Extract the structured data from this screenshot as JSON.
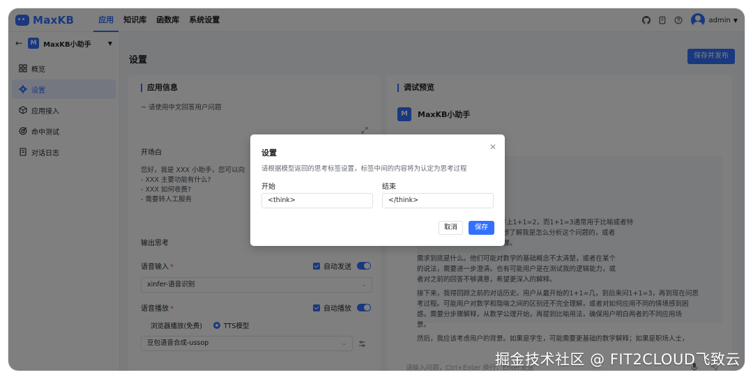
{
  "brand": {
    "name": "MaxKB",
    "color": "#3370ff"
  },
  "nav": {
    "items": [
      "应用",
      "知识库",
      "函数库",
      "系统设置"
    ],
    "active_index": 0
  },
  "topbar": {
    "user": "admin",
    "icons": [
      "github-icon",
      "book-icon",
      "help-icon"
    ]
  },
  "sidebar": {
    "app_badge": "M",
    "app_name": "MaxKB小助手",
    "items": [
      {
        "label": "概览",
        "icon": "grid-icon"
      },
      {
        "label": "设置",
        "icon": "gear-icon"
      },
      {
        "label": "应用接入",
        "icon": "cube-icon"
      },
      {
        "label": "命中测试",
        "icon": "target-icon"
      },
      {
        "label": "对话日志",
        "icon": "document-icon"
      }
    ],
    "active_index": 1
  },
  "main": {
    "title": "设置",
    "publish_label": "保存并发布"
  },
  "left_panel": {
    "title": "应用信息",
    "prompt_line": "~ 请使用中文回答用户问题",
    "opening_label": "开场白",
    "opening_lines": [
      "您好，我是 XXX 小助手，您可以向",
      "- XXX 主要功能有什么?",
      "- XXX 如何收费?",
      "- 需要转人工服务"
    ],
    "output_think_label": "输出思考",
    "voice_input": {
      "label": "语音输入",
      "auto_label": "自动发送",
      "model": "xinfer-语音识别"
    },
    "voice_play": {
      "label": "语音播放",
      "auto_label": "自动播放",
      "option_browser": "浏览器播放(免费)",
      "option_tts": "TTS模型",
      "model": "豆包语音合成-ussop"
    }
  },
  "right_panel": {
    "title": "调试预览",
    "bot_badge": "M",
    "bot_name": "MaxKB小助手",
    "chat_lines": [
      "=3，我之前已经解释过在数学上1+1=2，而1+1=3通常用于比喻或者特",
      "我\"说说思考过程\"，可能是在想了解我是怎么分析这个问题的，或者",
      "释有些困惑，需要更详细的步骤。",
      "需求到底是什么。他们可能对数学的基础概念不太清楚，或者在某个",
      "的说法，需要进一步澄清。也有可能用户是在测试我的逻辑能力，或",
      "者对之前的回答不够满意，希望更深入的解释。",
      "接下来，我得回顾之前的对话历史。用户从最开始的1+1=几，到后来问1+1=3，再到现在问思",
      "考过程。可能用户对数学和隐喻之间的区别还不完全理解，或者对如何应用不同的情境感到困",
      "惑。需要分步骤解释，从数学公理开始，再提到比喻用法，确保用户明白两者的不同应用场",
      "景。",
      "然后，我应该考虑用户的背景。如果是学生，可能需要更基础的数学解释；如果是职场人士，"
    ],
    "input_placeholder": "请输入问题，Ctrl+Enter 换行，Enter发送"
  },
  "dialog": {
    "title": "设置",
    "description": "请根据模型返回的思考标签设置，标签中间的内容将为认定为思考过程",
    "start_label": "开始",
    "start_value": "<think>",
    "end_label": "结束",
    "end_value": "</think>",
    "cancel_label": "取消",
    "save_label": "保存"
  },
  "watermark": "掘金技术社区 @ FIT2CLOUD飞致云"
}
